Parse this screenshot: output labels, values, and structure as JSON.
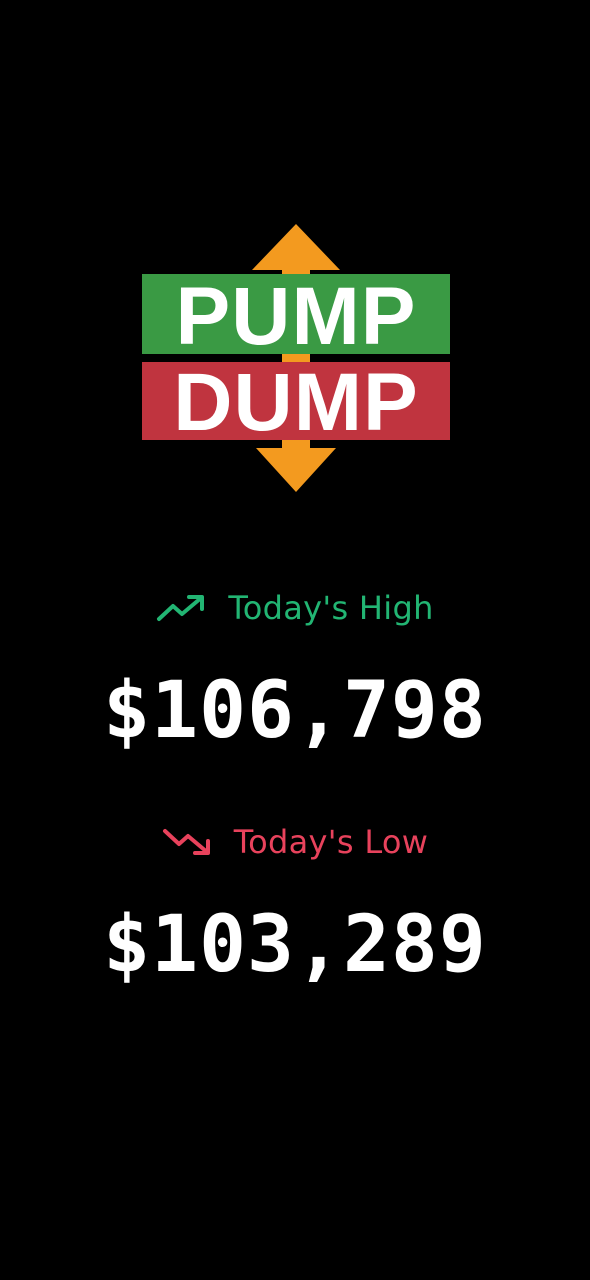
{
  "logo": {
    "line1": "PUMP",
    "line2": "DUMP",
    "colors": {
      "pump_bg": "#3a9a44",
      "dump_bg": "#c0343f",
      "arrow": "#f39a1f",
      "text": "#ffffff"
    },
    "icons": [
      "up-arrow-icon",
      "down-arrow-icon"
    ]
  },
  "high": {
    "label": "Today's High",
    "value": "$106,798",
    "icon": "trending-up-icon",
    "color": "#22b573"
  },
  "low": {
    "label": "Today's Low",
    "value": "$103,289",
    "icon": "trending-down-icon",
    "color": "#e8425c"
  }
}
